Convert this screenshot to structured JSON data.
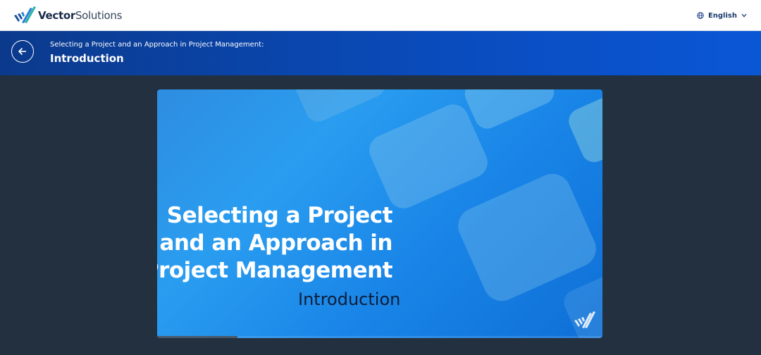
{
  "header": {
    "brand_bold": "Vector",
    "brand_rest": "Solutions",
    "language": "English"
  },
  "course": {
    "course_title": "Selecting a Project and an Approach in Project Management:",
    "section_title": "Introduction"
  },
  "slide": {
    "title_lines": [
      "Selecting a Project",
      "and an Approach in",
      "Project Management"
    ],
    "subtitle": "Introduction"
  },
  "progress": {
    "fraction": 0.18
  },
  "colors": {
    "header_blue_start": "#0b3a8c",
    "header_blue_end": "#0a57d6",
    "page_background": "#22303f",
    "slide_blue": "#2a9df0"
  },
  "icons": {
    "logo": "vector-solutions-logo-icon",
    "language": "globe-icon",
    "language_toggle": "chevron-down-icon",
    "back": "arrow-left-icon"
  }
}
